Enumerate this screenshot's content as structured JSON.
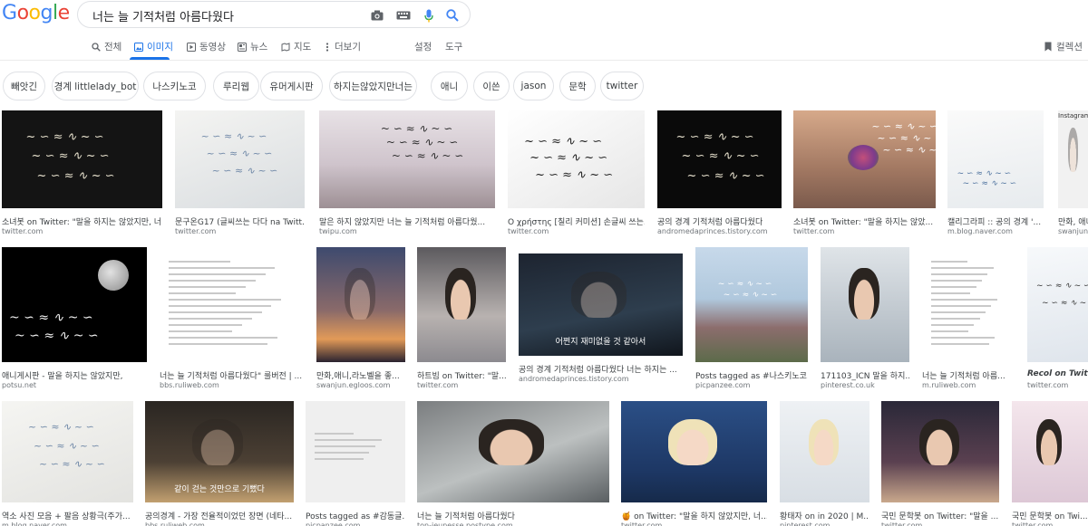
{
  "search": {
    "query": "너는 늘 기적처럼 아름다웠다",
    "icons": [
      "camera-icon",
      "keyboard-icon",
      "mic-icon",
      "search-icon"
    ]
  },
  "logo": {
    "letters": [
      "G",
      "o",
      "o",
      "g",
      "l",
      "e"
    ],
    "colors": [
      "#4285f4",
      "#ea4335",
      "#fbbc05",
      "#4285f4",
      "#34a853",
      "#ea4335"
    ]
  },
  "tabs": {
    "all": "전체",
    "images": "이미지",
    "videos": "동영상",
    "news": "뉴스",
    "maps": "지도",
    "more": "더보기",
    "settings": "설정",
    "tools": "도구",
    "collections": "컬렉션"
  },
  "chips": [
    "빼앗긴",
    "경계 littlelady_bot",
    "나스키노코",
    "루리웹",
    "유머게시판",
    "하지는않았지만너는",
    "애니",
    "이쓴",
    "jason",
    "문학",
    "twitter"
  ],
  "results": [
    {
      "caption": "소녀봇 on Twitter: \"말을 하지는 않았지만, 너...",
      "source": "twitter.com",
      "overlay": ""
    },
    {
      "caption": "문구온G17 (글씨쓰는 다다 na Twitt...",
      "source": "twitter.com",
      "overlay": ""
    },
    {
      "caption": "말은 하지 않았지만 너는 늘 기적처럼 아름다웠...",
      "source": "twipu.com",
      "overlay": ""
    },
    {
      "caption": "Ο χρήστης [칠리 커미션] 손글씨 쓰는...",
      "source": "twitter.com",
      "overlay": ""
    },
    {
      "caption": "공의 경계 기적처럼 아름다웠다",
      "source": "andromedaprinces.tistory.com",
      "overlay": ""
    },
    {
      "caption": "소녀봇 on Twitter: \"말을 하지는 않았...",
      "source": "twitter.com",
      "overlay": ""
    },
    {
      "caption": "캘리그라피 :: 공의 경계 '...",
      "source": "m.blog.naver.com",
      "overlay": ""
    },
    {
      "caption": "만화, 애니...",
      "source": "swanjun.e...",
      "overlay": "Instagram"
    },
    {
      "caption": "애니게시판 - 말을 하지는 않았지만,",
      "source": "potsu.net",
      "overlay": ""
    },
    {
      "caption": "너는 늘 기적처럼 아름다웠다\" 룰버전 | ...",
      "source": "bbs.ruliweb.com",
      "overlay": ""
    },
    {
      "caption": "만화,애니,라노벨을 좋...",
      "source": "swanjun.egloos.com",
      "overlay": ""
    },
    {
      "caption": "하트빔 on Twitter: \"말...",
      "source": "twitter.com",
      "overlay": ""
    },
    {
      "caption": "공의 경계 기적처럼 아름다웠다 너는 하지는 ...",
      "source": "andromedaprinces.tistory.com",
      "overlay": "어쩐지 재미없을 것 같아서"
    },
    {
      "caption": "Posts tagged as #나스키노코...",
      "source": "picpanzee.com",
      "overlay": ""
    },
    {
      "caption": "171103_ICN 말을 하지...",
      "source": "pinterest.co.uk",
      "overlay": ""
    },
    {
      "caption": "너는 늘 기적처럼 아름...",
      "source": "m.ruliweb.com",
      "overlay": ""
    },
    {
      "caption": "Recol on Twitter",
      "source": "twitter.com",
      "overlay": ""
    },
    {
      "caption": "역소 사진 모음 + 팔음 상황극(주가...",
      "source": "m.blog.naver.com",
      "overlay": ""
    },
    {
      "caption": "공의경계 - 가장 전율적이었던 장면 (네타...",
      "source": "bbs.ruliweb.com",
      "overlay": "같이 걷는 것만으로 기뻤다"
    },
    {
      "caption": "Posts tagged as #감동글...",
      "source": "picpanzee.com",
      "overlay": ""
    },
    {
      "caption": "너는 늘 기적처럼 아름다웠다",
      "source": "ton-jeunesse.postype.com",
      "overlay": ""
    },
    {
      "caption": "🍯 on Twitter: \"말을 하지 않았지만, 너...",
      "source": "twitter.com",
      "overlay": ""
    },
    {
      "caption": "황태자 on in 2020 | M...",
      "source": "pinterest.com",
      "overlay": ""
    },
    {
      "caption": "국민 문학봇 on Twitter: \"말을 ...",
      "source": "twitter.com",
      "overlay": ""
    },
    {
      "caption": "국민 문학봇 on Twi...",
      "source": "twitter.com",
      "overlay": ""
    }
  ]
}
